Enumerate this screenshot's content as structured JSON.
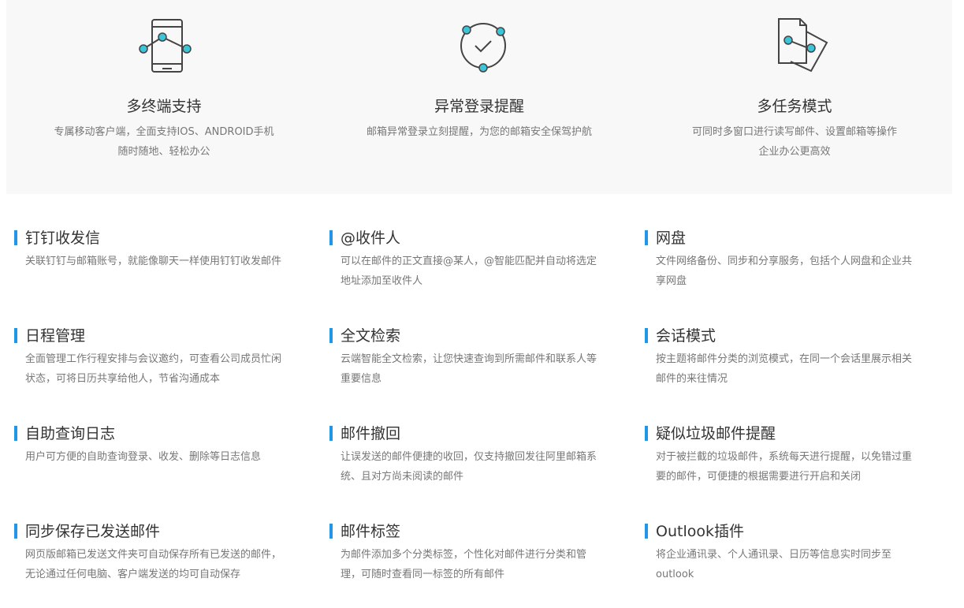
{
  "top_features": [
    {
      "icon": "mobile-devices-icon",
      "title": "多终端支持",
      "desc_lines": [
        "专属移动客户端，全面支持IOS、ANDROID手机",
        "随时随地、轻松办公"
      ]
    },
    {
      "icon": "login-alert-icon",
      "title": "异常登录提醒",
      "desc_lines": [
        "邮箱异常登录立刻提醒，为您的邮箱安全保驾护航",
        ""
      ]
    },
    {
      "icon": "multitask-docs-icon",
      "title": "多任务模式",
      "desc_lines": [
        "可同时多窗口进行读写邮件、设置邮箱等操作",
        "企业办公更高效"
      ]
    }
  ],
  "features": [
    {
      "title": "钉钉收发信",
      "desc": "关联钉钉与邮箱账号，就能像聊天一样使用钉钉收发邮件"
    },
    {
      "title": "@收件人",
      "desc": "可以在邮件的正文直接@某人，@智能匹配并自动将选定地址添加至收件人"
    },
    {
      "title": "网盘",
      "desc": "文件网络备份、同步和分享服务，包括个人网盘和企业共享网盘"
    },
    {
      "title": "日程管理",
      "desc": "全面管理工作行程安排与会议邀约，可查看公司成员忙闲状态，可将日历共享给他人，节省沟通成本"
    },
    {
      "title": "全文检索",
      "desc": "云端智能全文检索，让您快速查询到所需邮件和联系人等重要信息"
    },
    {
      "title": "会话模式",
      "desc": "按主题将邮件分类的浏览模式，在同一个会话里展示相关邮件的来往情况"
    },
    {
      "title": "自助查询日志",
      "desc": "用户可方便的自助查询登录、收发、删除等日志信息"
    },
    {
      "title": "邮件撤回",
      "desc": "让误发送的邮件便捷的收回，仅支持撤回发往阿里邮箱系统、且对方尚未阅读的邮件"
    },
    {
      "title": "疑似垃圾邮件提醒",
      "desc": "对于被拦截的垃圾邮件，系统每天进行提醒，以免错过重要的邮件，可便捷的根据需要进行开启和关闭"
    },
    {
      "title": "同步保存已发送邮件",
      "desc": "网页版邮箱已发送文件夹可自动保存所有已发送的邮件，无论通过任何电脑、客户端发送的均可自动保存"
    },
    {
      "title": "邮件标签",
      "desc": "为邮件添加多个分类标签，个性化对邮件进行分类和管理，可随时查看同一标签的所有邮件"
    },
    {
      "title": "Outlook插件",
      "desc": "将企业通讯录、个人通讯录、日历等信息实时同步至outlook"
    }
  ],
  "colors": {
    "accent": "#2196e6",
    "icon_dot": "#3cc4d8",
    "icon_stroke": "#444444",
    "band_bg": "#f8f8f8"
  }
}
